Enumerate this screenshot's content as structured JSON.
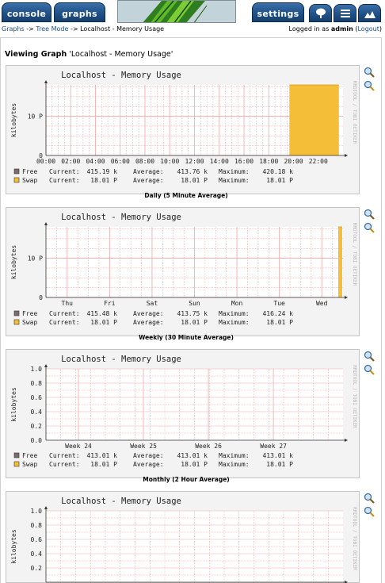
{
  "header": {
    "tabs": [
      {
        "label": "console"
      },
      {
        "label": "graphs"
      },
      {
        "label": "settings"
      }
    ],
    "icon_tabs": [
      "tree-view-icon",
      "list-view-icon",
      "preview-view-icon"
    ]
  },
  "breadcrumb": {
    "graphs": "Graphs",
    "sep1": " -> ",
    "tree_mode": "Tree Mode",
    "sep2": " -> ",
    "current": "Localhost - Memory Usage"
  },
  "login": {
    "prefix": "Logged in as ",
    "user": "admin",
    "open": " (",
    "logout": "Logout",
    "close": ")"
  },
  "viewing": {
    "prefix": "Viewing Graph",
    "name": " 'Localhost - Memory Usage'"
  },
  "colors": {
    "free": "#7d6b6b",
    "swap": "#f5be39",
    "grid": "#f2a8a8",
    "plot_bg": "#ffffff"
  },
  "graphs": [
    {
      "title": "Localhost - Memory Usage",
      "ylabel": "kilobytes",
      "side_label": "RRDTOOL / TOBI OETIKER",
      "caption": "Daily (5 Minute Average)",
      "legend": [
        {
          "name": "Free",
          "current": "415.19 k",
          "average": "413.76 k",
          "maximum": "420.18 k"
        },
        {
          "name": "Swap",
          "current": "18.01 P",
          "average": "18.01 P",
          "maximum": "18.01 P"
        }
      ]
    },
    {
      "title": "Localhost - Memory Usage",
      "ylabel": "kilobytes",
      "side_label": "RRDTOOL / TOBI OETIKER",
      "caption": "Weekly (30 Minute Average)",
      "legend": [
        {
          "name": "Free",
          "current": "415.48 k",
          "average": "413.75 k",
          "maximum": "416.24 k"
        },
        {
          "name": "Swap",
          "current": "18.01 P",
          "average": "18.01 P",
          "maximum": "18.01 P"
        }
      ]
    },
    {
      "title": "Localhost - Memory Usage",
      "ylabel": "kilobytes",
      "side_label": "RRDTOOL / TOBI OETIKER",
      "caption": "Monthly (2 Hour Average)",
      "legend": [
        {
          "name": "Free",
          "current": "413.01 k",
          "average": "413.01 k",
          "maximum": "413.01 k"
        },
        {
          "name": "Swap",
          "current": "18.01 P",
          "average": "18.01 P",
          "maximum": "18.01 P"
        }
      ]
    },
    {
      "title": "Localhost - Memory Usage",
      "ylabel": "kilobytes",
      "side_label": "RRDTOOL / TOBI OETIKER",
      "caption": "",
      "legend": []
    }
  ],
  "legend_labels": {
    "current": "Current:",
    "average": "Average:",
    "maximum": "Maximum:"
  },
  "chart_data": [
    {
      "type": "area",
      "title": "Localhost - Memory Usage",
      "ylabel": "kilobytes",
      "x_ticks": [
        "00:00",
        "02:00",
        "04:00",
        "06:00",
        "08:00",
        "10:00",
        "12:00",
        "14:00",
        "16:00",
        "18:00",
        "20:00",
        "22:00"
      ],
      "y_ticks": [
        "0",
        "10 P"
      ],
      "ylim": [
        0,
        18.01
      ],
      "y_unit": "P",
      "series": [
        {
          "name": "Swap",
          "x_start": "19:40",
          "x_end": "23:40",
          "value": 18.01
        }
      ]
    },
    {
      "type": "area",
      "title": "Localhost - Memory Usage",
      "ylabel": "kilobytes",
      "x_ticks": [
        "Thu",
        "Fri",
        "Sat",
        "Sun",
        "Mon",
        "Tue",
        "Wed"
      ],
      "y_ticks": [
        "0",
        "10 P"
      ],
      "ylim": [
        0,
        18.01
      ],
      "y_unit": "P",
      "series": [
        {
          "name": "Swap",
          "x_start": "Wed (late)",
          "x_end": "Wed (end)",
          "value": 18.01
        }
      ]
    },
    {
      "type": "area",
      "title": "Localhost - Memory Usage",
      "ylabel": "kilobytes",
      "x_ticks": [
        "Week 24",
        "Week 25",
        "Week 26",
        "Week 27"
      ],
      "y_ticks": [
        "0.0",
        "0.2",
        "0.4",
        "0.6",
        "0.8",
        "1.0"
      ],
      "ylim": [
        0,
        1.0
      ],
      "series": []
    },
    {
      "type": "area",
      "title": "Localhost - Memory Usage",
      "ylabel": "kilobytes",
      "x_ticks": [],
      "y_ticks": [
        "0.2",
        "0.4",
        "0.6",
        "0.8",
        "1.0"
      ],
      "ylim": [
        0,
        1.0
      ],
      "series": []
    }
  ]
}
